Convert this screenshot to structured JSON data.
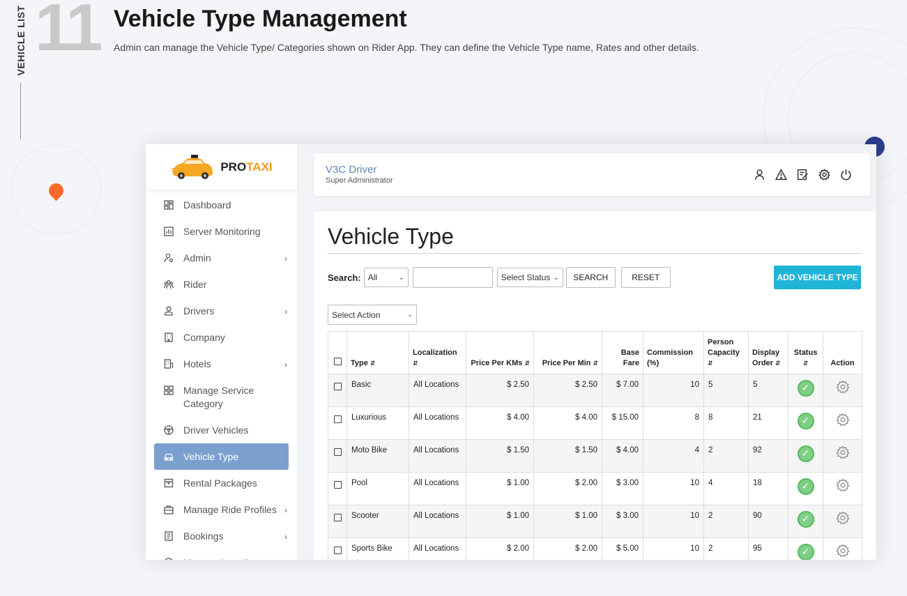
{
  "slide": {
    "side_label": "VEHICLE LIST",
    "number": "11",
    "title": "Vehicle Type Management",
    "subtitle": "Admin can manage the Vehicle Type/ Categories shown on Rider App. They can define the Vehicle Type name, Rates and other details."
  },
  "brand": {
    "logo_part1": "PRO",
    "logo_part2": "TAXI"
  },
  "sidebar": {
    "items": [
      {
        "label": "Dashboard",
        "icon": "dashboard-icon",
        "chevron": false
      },
      {
        "label": "Server Monitoring",
        "icon": "chart-icon",
        "chevron": false
      },
      {
        "label": "Admin",
        "icon": "user-gear-icon",
        "chevron": true
      },
      {
        "label": "Rider",
        "icon": "group-icon",
        "chevron": false
      },
      {
        "label": "Drivers",
        "icon": "driver-icon",
        "chevron": true
      },
      {
        "label": "Company",
        "icon": "building-icon",
        "chevron": false
      },
      {
        "label": "Hotels",
        "icon": "hotel-icon",
        "chevron": true
      },
      {
        "label": "Manage Service Category",
        "icon": "grid-icon",
        "chevron": false
      },
      {
        "label": "Driver Vehicles",
        "icon": "steering-wheel-icon",
        "chevron": false
      },
      {
        "label": "Vehicle Type",
        "icon": "car-icon",
        "chevron": false,
        "active": true
      },
      {
        "label": "Rental Packages",
        "icon": "package-icon",
        "chevron": false
      },
      {
        "label": "Manage Ride Profiles",
        "icon": "briefcase-icon",
        "chevron": true
      },
      {
        "label": "Bookings",
        "icon": "list-icon",
        "chevron": true
      },
      {
        "label": "Manage Locations",
        "icon": "location-icon",
        "chevron": true
      }
    ]
  },
  "header": {
    "user_name": "V3C Driver",
    "user_role": "Super Administrator"
  },
  "main": {
    "title": "Vehicle Type",
    "search_label": "Search:",
    "search_field_select": "All",
    "search_input_value": "",
    "status_select": "Select Status",
    "search_button": "SEARCH",
    "reset_button": "RESET",
    "add_button": "ADD VEHICLE TYPE",
    "action_select": "Select Action",
    "columns": [
      "Type",
      "Localization",
      "Price Per KMs",
      "Price Per Min",
      "Base Fare",
      "Commission (%)",
      "Person Capacity",
      "Display Order",
      "Status",
      "Action"
    ],
    "rows": [
      {
        "type": "Basic",
        "localization": "All Locations",
        "price_km": "$ 2.50",
        "price_min": "$ 2.50",
        "base_fare": "$ 7.00",
        "commission": "10",
        "capacity": "5",
        "order": "5"
      },
      {
        "type": "Luxurious",
        "localization": "All Locations",
        "price_km": "$ 4.00",
        "price_min": "$ 4.00",
        "base_fare": "$ 15.00",
        "commission": "8",
        "capacity": "8",
        "order": "21"
      },
      {
        "type": "Moto Bike",
        "localization": "All Locations",
        "price_km": "$ 1.50",
        "price_min": "$ 1.50",
        "base_fare": "$ 4.00",
        "commission": "4",
        "capacity": "2",
        "order": "92"
      },
      {
        "type": "Pool",
        "localization": "All Locations",
        "price_km": "$ 1.00",
        "price_min": "$ 2.00",
        "base_fare": "$ 3.00",
        "commission": "10",
        "capacity": "4",
        "order": "18"
      },
      {
        "type": "Scooter",
        "localization": "All Locations",
        "price_km": "$ 1.00",
        "price_min": "$ 1.00",
        "base_fare": "$ 3.00",
        "commission": "10",
        "capacity": "2",
        "order": "90"
      },
      {
        "type": "Sports Bike",
        "localization": "All Locations",
        "price_km": "$ 2.00",
        "price_min": "$ 2.00",
        "base_fare": "$ 5.00",
        "commission": "10",
        "capacity": "2",
        "order": "95"
      }
    ]
  },
  "colors": {
    "accent": "#1fb5d6",
    "active_nav": "#7b9fcf",
    "status_ok": "#7fcf86",
    "logo_orange": "#f39c1a"
  }
}
